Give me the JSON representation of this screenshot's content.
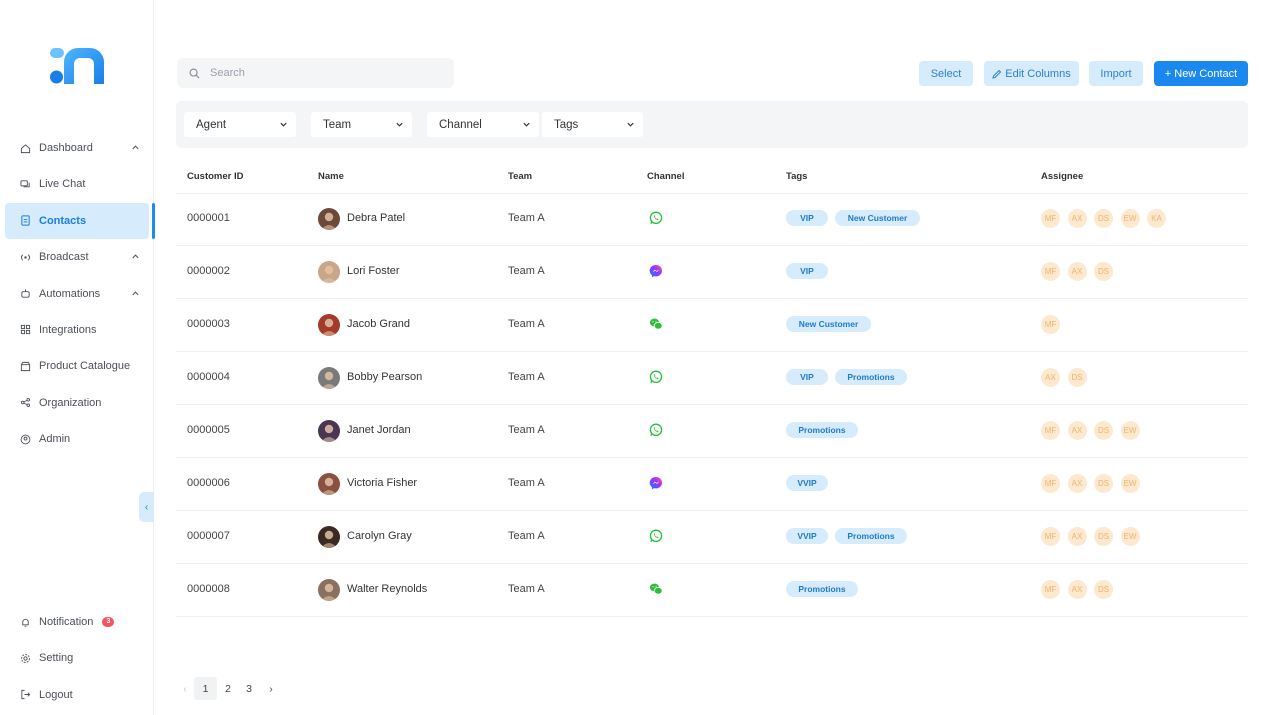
{
  "sidebar": {
    "nav": [
      {
        "label": "Dashboard",
        "icon": "home-icon",
        "chevron": true
      },
      {
        "label": "Live Chat",
        "icon": "chat-icon",
        "chevron": false
      },
      {
        "label": "Contacts",
        "icon": "contacts-icon",
        "chevron": false,
        "active": true
      },
      {
        "label": "Broadcast",
        "icon": "broadcast-icon",
        "chevron": true
      },
      {
        "label": "Automations",
        "icon": "robot-icon",
        "chevron": true
      },
      {
        "label": "Integrations",
        "icon": "grid-icon",
        "chevron": false
      },
      {
        "label": "Product Catalogue",
        "icon": "store-icon",
        "chevron": false
      },
      {
        "label": "Organization",
        "icon": "share-icon",
        "chevron": false
      },
      {
        "label": "Admin",
        "icon": "user-circle-icon",
        "chevron": false
      }
    ],
    "bottom": [
      {
        "label": "Notification",
        "icon": "bell-icon",
        "badge": "3"
      },
      {
        "label": "Setting",
        "icon": "gear-icon"
      },
      {
        "label": "Logout",
        "icon": "logout-icon"
      }
    ]
  },
  "toolbar": {
    "search_placeholder": "Search",
    "select_label": "Select",
    "edit_columns_label": "Edit Columns",
    "import_label": "Import",
    "new_contact_label": "+ New Contact"
  },
  "filters": [
    "Agent",
    "Team",
    "Channel",
    "Tags"
  ],
  "table": {
    "headers": [
      "Customer ID",
      "Name",
      "Team",
      "Channel",
      "Tags",
      "Assignee"
    ],
    "rows": [
      {
        "id": "0000001",
        "name": "Debra Patel",
        "team": "Team A",
        "channel": "whatsapp",
        "tags": [
          "VIP",
          "New Customer"
        ],
        "assignees": [
          "MF",
          "AX",
          "DS",
          "EW",
          "KA"
        ],
        "avatar_color": "#6b4a3a"
      },
      {
        "id": "0000002",
        "name": "Lori Foster",
        "team": "Team A",
        "channel": "messenger",
        "tags": [
          "VIP"
        ],
        "assignees": [
          "MF",
          "AX",
          "DS"
        ],
        "avatar_color": "#c9a58a"
      },
      {
        "id": "0000003",
        "name": "Jacob Grand",
        "team": "Team A",
        "channel": "wechat",
        "tags": [
          "New Customer"
        ],
        "assignees": [
          "MF"
        ],
        "avatar_color": "#a33a2a"
      },
      {
        "id": "0000004",
        "name": "Bobby Pearson",
        "team": "Team A",
        "channel": "whatsapp",
        "tags": [
          "VIP",
          "Promotions"
        ],
        "assignees": [
          "AX",
          "DS"
        ],
        "avatar_color": "#7a7a7a"
      },
      {
        "id": "0000005",
        "name": "Janet Jordan",
        "team": "Team A",
        "channel": "whatsapp",
        "tags": [
          "Promotions"
        ],
        "assignees": [
          "MF",
          "AX",
          "DS",
          "EW"
        ],
        "avatar_color": "#4a3552"
      },
      {
        "id": "0000006",
        "name": "Victoria Fisher",
        "team": "Team A",
        "channel": "messenger",
        "tags": [
          "VVIP"
        ],
        "assignees": [
          "MF",
          "AX",
          "DS",
          "EW"
        ],
        "avatar_color": "#8a5040"
      },
      {
        "id": "0000007",
        "name": "Carolyn Gray",
        "team": "Team A",
        "channel": "whatsapp",
        "tags": [
          "VVIP",
          "Promotions"
        ],
        "assignees": [
          "MF",
          "AX",
          "DS",
          "EW"
        ],
        "avatar_color": "#3a2a22"
      },
      {
        "id": "0000008",
        "name": "Walter Reynolds",
        "team": "Team A",
        "channel": "wechat",
        "tags": [
          "Promotions"
        ],
        "assignees": [
          "MF",
          "AX",
          "DS"
        ],
        "avatar_color": "#8a7060"
      }
    ]
  },
  "pagination": {
    "pages": [
      "1",
      "2",
      "3"
    ],
    "current": "1",
    "prev": "‹",
    "next": "›"
  },
  "colors": {
    "accent": "#1a88ee",
    "tag_bg": "#d6ebfb",
    "assignee_bg": "#fde9cf",
    "whatsapp": "#25c03b",
    "wechat": "#2dbd3a"
  }
}
